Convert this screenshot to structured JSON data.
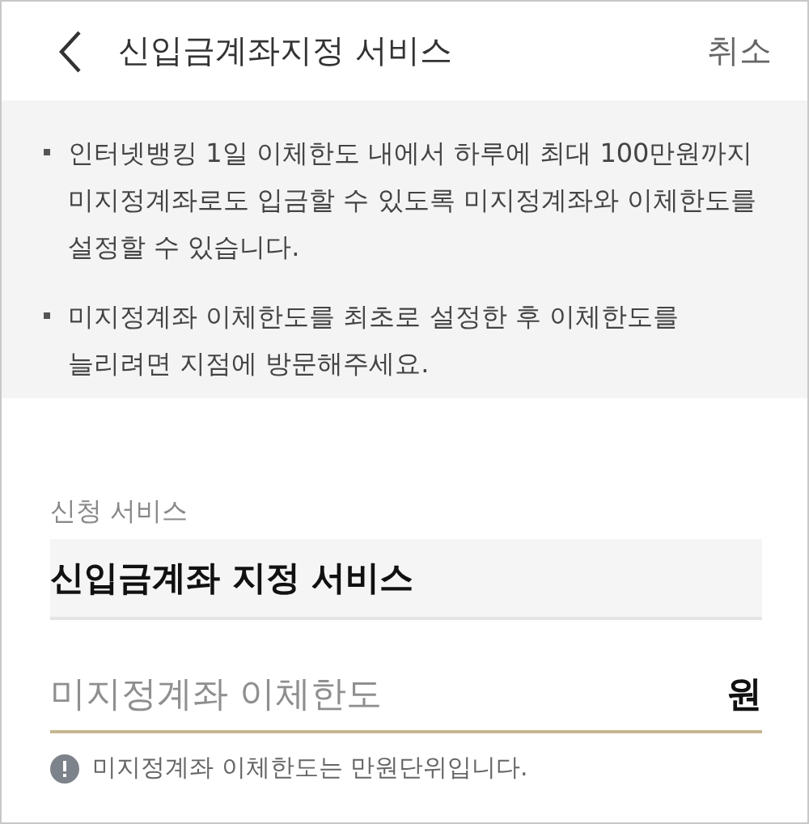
{
  "header": {
    "title": "신입금계좌지정 서비스",
    "cancel": "취소"
  },
  "notices": [
    "인터넷뱅킹 1일 이체한도 내에서 하루에 최대 100만원까지 미지정계좌로도 입금할 수 있도록 미지정계좌와 이체한도를 설정할 수 있습니다.",
    "미지정계좌 이체한도를 최초로 설정한 후 이체한도를 늘리려면 지점에 방문해주세요."
  ],
  "service": {
    "label": "신청 서비스",
    "value": "신입금계좌 지정 서비스"
  },
  "limit": {
    "placeholder": "미지정계좌 이체한도",
    "unit": "원",
    "hint": "미지정계좌 이체한도는 만원단위입니다."
  }
}
